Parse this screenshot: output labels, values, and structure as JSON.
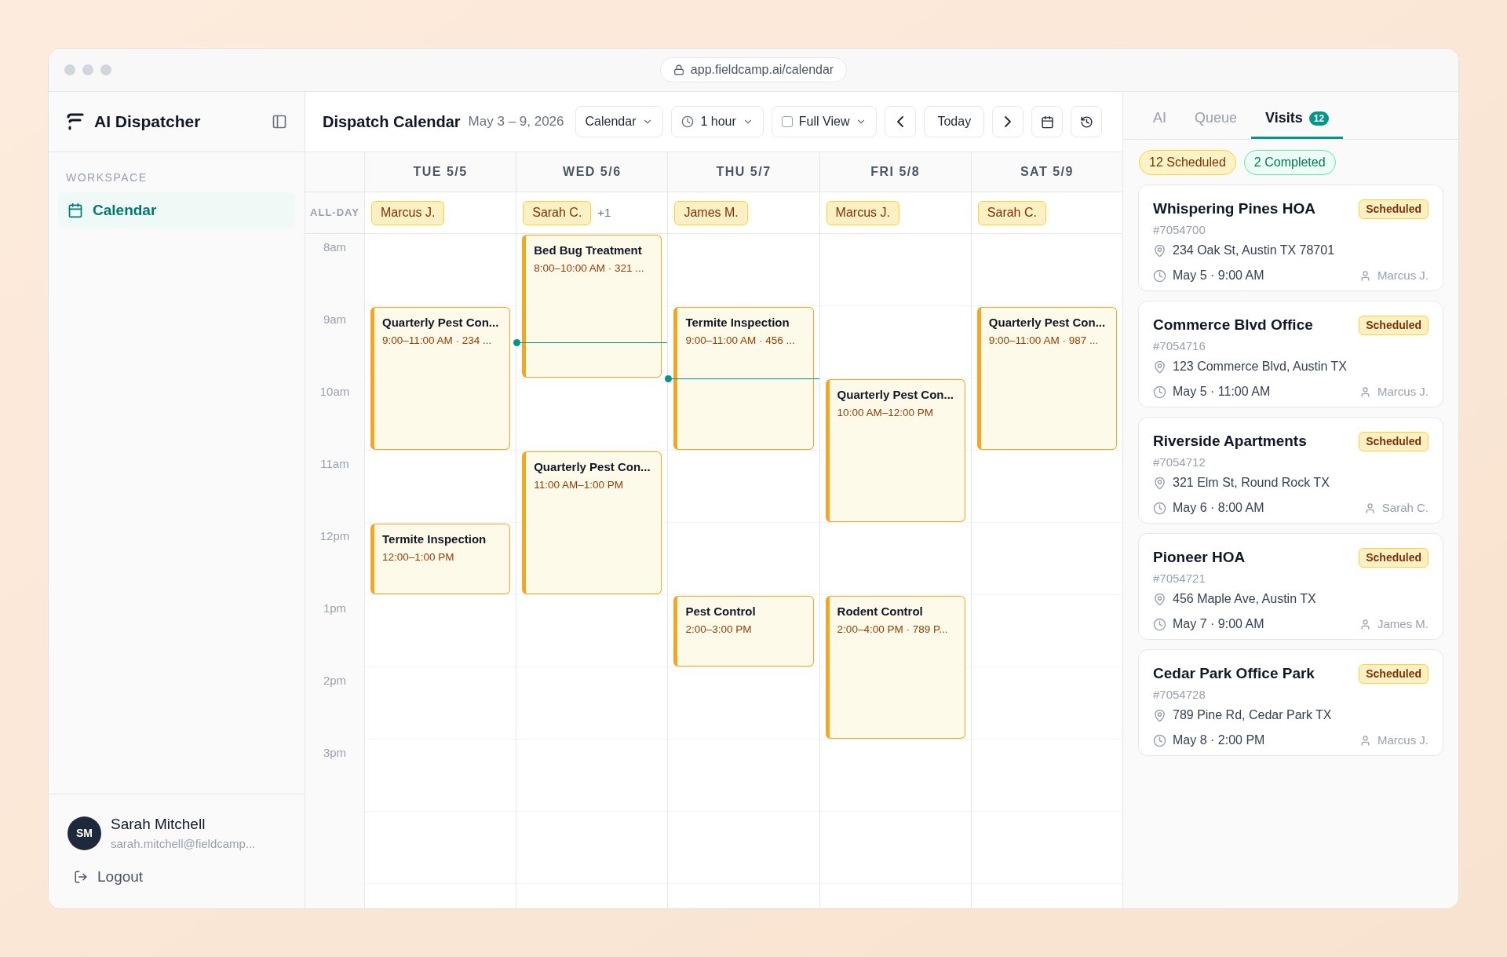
{
  "browser": {
    "url": "app.fieldcamp.ai/calendar"
  },
  "sidebar": {
    "app_name": "AI Dispatcher",
    "section": "WORKSPACE",
    "items": [
      {
        "label": "Calendar",
        "selected": true
      }
    ],
    "user": {
      "initials": "SM",
      "name": "Sarah Mitchell",
      "email": "sarah.mitchell@fieldcamp..."
    },
    "logout": "Logout"
  },
  "header": {
    "title": "Dispatch Calendar",
    "date_range": "May 3 – 9, 2026",
    "controls": [
      {
        "kind": "dropdown",
        "label": "Calendar"
      },
      {
        "kind": "clock-dropdown",
        "label": "1 hour"
      },
      {
        "kind": "checkbox-dropdown",
        "label": "Full View",
        "checked": false
      },
      {
        "kind": "prev"
      },
      {
        "kind": "button",
        "label": "Today"
      },
      {
        "kind": "next"
      },
      {
        "kind": "calendar"
      },
      {
        "kind": "history"
      }
    ]
  },
  "calendar": {
    "all_day_label": "ALL-DAY",
    "hours": [
      "8am",
      "9am",
      "10am",
      "11am",
      "12pm",
      "1pm",
      "2pm",
      "3pm"
    ],
    "days": [
      {
        "label": "TUE 5/5",
        "all_day": [
          {
            "name": "Marcus J."
          }
        ],
        "slots": [
          {
            "kind": "free"
          },
          {
            "kind": "event",
            "title": "Quarterly Pest Con...",
            "time": "9:00–11:00 AM · 234 ..."
          },
          {
            "kind": "continued"
          },
          {
            "kind": "free"
          },
          {
            "kind": "event",
            "title": "Termite Inspection",
            "time": "12:00–1:00 PM"
          }
        ]
      },
      {
        "label": "WED 5/6",
        "all_day": [
          {
            "name": "Sarah C."
          }
        ],
        "more": "+1",
        "slots": [
          {
            "kind": "event",
            "title": "Bed Bug Treatment",
            "time": "8:00–10:00 AM · 321 ..."
          },
          {
            "kind": "continued",
            "now_line": {
              "kind": "half"
            }
          },
          {
            "kind": "free"
          },
          {
            "kind": "event",
            "title": "Quarterly Pest Con...",
            "time": "11:00 AM–1:00 PM"
          },
          {
            "kind": "continued"
          }
        ]
      },
      {
        "label": "THU 5/7",
        "all_day": [
          {
            "name": "James M."
          }
        ],
        "slots": [
          {
            "kind": "free"
          },
          {
            "kind": "event",
            "title": "Termite Inspection",
            "time": "9:00–11:00 AM · 456 ..."
          },
          {
            "kind": "continued",
            "now_line": {
              "kind": "start"
            }
          },
          {
            "kind": "free"
          },
          {
            "kind": "free"
          },
          {
            "kind": "event",
            "title": "Pest Control",
            "time": "2:00–3:00 PM"
          }
        ]
      },
      {
        "label": "FRI 5/8",
        "all_day": [
          {
            "name": "Marcus J."
          }
        ],
        "slots": [
          {
            "kind": "free"
          },
          {
            "kind": "free"
          },
          {
            "kind": "event",
            "title": "Quarterly Pest Con...",
            "time": "10:00 AM–12:00 PM"
          },
          {
            "kind": "continued"
          },
          {
            "kind": "free"
          },
          {
            "kind": "event",
            "title": "Rodent Control",
            "time": "2:00–4:00 PM · 789 P..."
          },
          {
            "kind": "continued"
          }
        ]
      },
      {
        "label": "SAT 5/9",
        "all_day": [
          {
            "name": "Sarah C."
          }
        ],
        "slots": [
          {
            "kind": "free"
          },
          {
            "kind": "event",
            "title": "Quarterly Pest Con...",
            "time": "9:00–11:00 AM · 987 ..."
          },
          {
            "kind": "continued"
          }
        ]
      }
    ]
  },
  "panel": {
    "tabs": [
      {
        "label": "AI",
        "selected": false
      },
      {
        "label": "Queue",
        "selected": false
      },
      {
        "label": "Visits",
        "selected": true,
        "badge": "12"
      }
    ],
    "filters": [
      {
        "label": "12 Scheduled",
        "kind": "scheduled"
      },
      {
        "label": "2 Completed",
        "kind": "completed"
      }
    ],
    "visits": [
      {
        "name": "Whispering Pines HOA",
        "status": "Scheduled",
        "id": "#7054700",
        "address": "234 Oak St, Austin TX 78701",
        "when": "May 5 · 9:00 AM",
        "tech": "Marcus J."
      },
      {
        "name": "Commerce Blvd Office",
        "status": "Scheduled",
        "id": "#7054716",
        "address": "123 Commerce Blvd, Austin TX",
        "when": "May 5 · 11:00 AM",
        "tech": "Marcus J."
      },
      {
        "name": "Riverside Apartments",
        "status": "Scheduled",
        "id": "#7054712",
        "address": "321 Elm St, Round Rock TX",
        "when": "May 6 · 8:00 AM",
        "tech": "Sarah C."
      },
      {
        "name": "Pioneer HOA",
        "status": "Scheduled",
        "id": "#7054721",
        "address": "456 Maple Ave, Austin TX",
        "when": "May 7 · 9:00 AM",
        "tech": "James M."
      },
      {
        "name": "Cedar Park Office Park",
        "status": "Scheduled",
        "id": "#7054728",
        "address": "789 Pine Rd, Cedar Park TX",
        "when": "May 8 · 2:00 PM",
        "tech": "Marcus J."
      }
    ]
  }
}
